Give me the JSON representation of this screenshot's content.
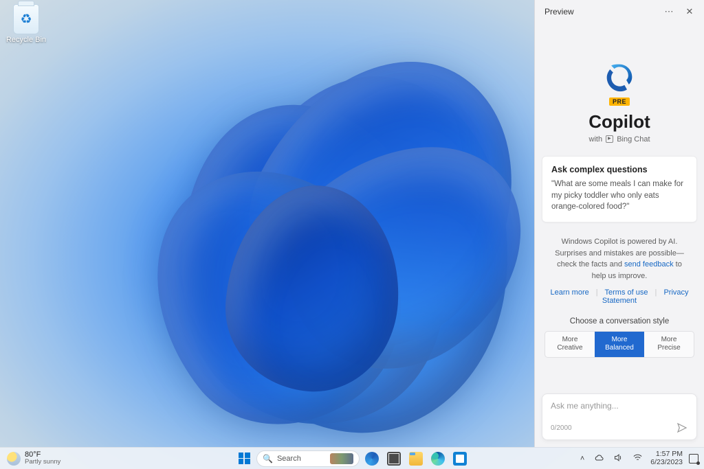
{
  "desktop": {
    "recycle_bin_label": "Recycle Bin"
  },
  "copilot": {
    "header_title": "Preview",
    "pre_badge": "PRE",
    "title": "Copilot",
    "subtitle_prefix": "with",
    "subtitle_suffix": "Bing Chat",
    "card": {
      "heading": "Ask complex questions",
      "example": "\"What are some meals I can make for my picky toddler who only eats orange-colored food?\""
    },
    "disclaimer_pre": "Windows Copilot is powered by AI. Surprises and mistakes are possible—check the facts and ",
    "disclaimer_link": "send feedback",
    "disclaimer_post": " to help us improve.",
    "links": {
      "learn": "Learn more",
      "terms": "Terms of use",
      "privacy": "Privacy Statement"
    },
    "style_label": "Choose a conversation style",
    "styles": [
      {
        "line1": "More",
        "line2": "Creative",
        "selected": false
      },
      {
        "line1": "More",
        "line2": "Balanced",
        "selected": true
      },
      {
        "line1": "More",
        "line2": "Precise",
        "selected": false
      }
    ],
    "input": {
      "placeholder": "Ask me anything...",
      "counter": "0/2000"
    }
  },
  "taskbar": {
    "weather": {
      "temp": "80°F",
      "condition": "Partly sunny"
    },
    "search_placeholder": "Search",
    "clock": {
      "time": "1:57 PM",
      "date": "6/23/2023"
    }
  }
}
